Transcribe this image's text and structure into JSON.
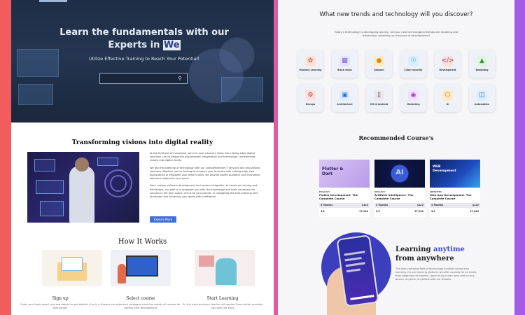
{
  "left": {
    "hero": {
      "title_main": "Learn the fundamentals with our Experts in ",
      "title_highlight": "We",
      "subtitle": "Utilize Effective Training to Reach Your Potential!",
      "search_placeholder": ""
    },
    "transform": {
      "title": "Transforming visions into digital reality",
      "paragraphs": [
        "At the forefront of innovation, we turn your visionary ideas into cutting-edge digital solutions. Let us bridge the gap between imagination and technology, transforming visions into digital reality.",
        "We ask the potential of technology with our comprehensive IT services and educational solutions. Whether you're looking to enhance your business with cutting-edge web applications or empower your team's skills, we provide expert guidance and innovative solutions tailored to your goals.",
        "From custom software development and system integration to hands-on training and workshops, our goal is to empower you with the knowledge and tools necessary for success in the tech space. Let us be your partner in navigating the ever-evolving tech landscape and achieving your goals with confidence."
      ],
      "button": "Explore More"
    },
    "how": {
      "title": "How It Works",
      "steps": [
        {
          "label": "Sign up",
          "desc": "Enter your basic email, and see details to get started. It only is that simple"
        },
        {
          "label": "Select course",
          "desc": "Browse our extensive catalogue covering variety of courses for perfect your development"
        },
        {
          "label": "Start Learning",
          "desc": "On the track and your teacher will explain them better provides you with the skills"
        }
      ]
    }
  },
  "right": {
    "trends": {
      "title": "What new trends and technology will you discover?",
      "subtitle": "Today's technology is developing quickly, and our new technological trends are enabling and advancing, speeding up the pace of development!",
      "items": [
        {
          "label": "Machine Learning",
          "icon": "brain-icon"
        },
        {
          "label": "Block chain",
          "icon": "blockchain-icon"
        },
        {
          "label": "Amazon",
          "icon": "amazon-icon"
        },
        {
          "label": "Cyber security",
          "icon": "cyber-icon"
        },
        {
          "label": "Development",
          "icon": "code-icon"
        },
        {
          "label": "Designing",
          "icon": "design-icon"
        },
        {
          "label": "Devops",
          "icon": "devops-icon"
        },
        {
          "label": "Architecture",
          "icon": "architecture-icon"
        },
        {
          "label": "iOS & Android",
          "icon": "mobile-icon"
        },
        {
          "label": "Marketing",
          "icon": "marketing-icon"
        },
        {
          "label": "UI",
          "icon": "ui-icon"
        },
        {
          "label": "Automation",
          "icon": "automation-icon"
        }
      ]
    },
    "recommended": {
      "title": "Recommended Course's",
      "courses": [
        {
          "category": "ENGLISH",
          "name": "Flutter Development- The Complete Course",
          "duration": "3 Months",
          "price": "$122",
          "lessons": "3/2",
          "students": "27,000",
          "img_text": "Flutter & Dart"
        },
        {
          "category": "ENGLISH",
          "name": "Artificial Intelligence- The Complete Course",
          "duration": "3 Months",
          "price": "$122",
          "lessons": "3/2",
          "students": "27,000",
          "img_text": "AI"
        },
        {
          "category": "WEBSITES",
          "name": "Web App Development- The Complete Course",
          "duration": "3 Months",
          "price": "$122",
          "lessons": "3/2",
          "students": "27,000",
          "img_text": "WEB Development"
        }
      ]
    },
    "learning": {
      "title_pre": "Learning ",
      "title_accent": "anytime",
      "title_post": "from anywhere",
      "text": "The ever-changing field of technology involves continuous learning. On our learning platform we offer courses for all levels, from beginners to experts. Learn at your own pace and on any device, anytime, anywhere with our lessons."
    }
  }
}
